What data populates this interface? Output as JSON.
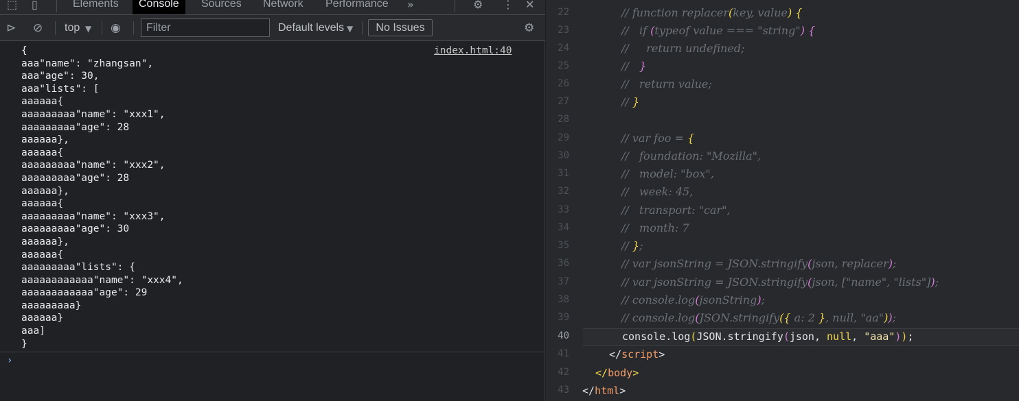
{
  "devtools": {
    "tabs": [
      "Elements",
      "Console",
      "Sources",
      "Network",
      "Performance"
    ],
    "more_tabs_icon": "chevron-double-right-icon",
    "toolbar": {
      "context": "top",
      "filter_placeholder": "Filter",
      "levels": "Default levels",
      "issues": "No Issues"
    },
    "console": {
      "source_link": "index.html:40",
      "log_lines": [
        "{",
        "aaa\"name\": \"zhangsan\",",
        "aaa\"age\": 30,",
        "aaa\"lists\": [",
        "aaaaaa{",
        "aaaaaaaaa\"name\": \"xxx1\",",
        "aaaaaaaaa\"age\": 28",
        "aaaaaa},",
        "aaaaaa{",
        "aaaaaaaaa\"name\": \"xxx2\",",
        "aaaaaaaaa\"age\": 28",
        "aaaaaa},",
        "aaaaaa{",
        "aaaaaaaaa\"name\": \"xxx3\",",
        "aaaaaaaaa\"age\": 30",
        "aaaaaa},",
        "aaaaaa{",
        "aaaaaaaaa\"lists\": {",
        "aaaaaaaaaaaa\"name\": \"xxx4\",",
        "aaaaaaaaaaaa\"age\": 29",
        "aaaaaaaaa}",
        "aaaaaa}",
        "aaa]",
        "}"
      ],
      "prompt": "›"
    }
  },
  "editor": {
    "line_numbers": [
      "22",
      "23",
      "24",
      "25",
      "26",
      "27",
      "28",
      "29",
      "30",
      "31",
      "32",
      "33",
      "34",
      "35",
      "36",
      "37",
      "38",
      "39",
      "40",
      "41",
      "42",
      "43"
    ],
    "l22": {
      "a": "// function replacer",
      "b": "(",
      "c": "key, value",
      "d": ") ",
      "e": "{"
    },
    "l23": {
      "a": "//   if ",
      "b": "(",
      "c": "typeof value === \"string\"",
      "d": ") ",
      "e": "{"
    },
    "l24": "//     return undefined;",
    "l25": {
      "a": "//   ",
      "b": "}"
    },
    "l26": "//   return value;",
    "l27": {
      "a": "// ",
      "b": "}"
    },
    "l29": {
      "a": "// var foo = ",
      "b": "{"
    },
    "l30": "//   foundation: \"Mozilla\",",
    "l31": "//   model: \"box\",",
    "l32": "//   week: 45,",
    "l33": "//   transport: \"car\",",
    "l34": "//   month: 7",
    "l35": {
      "a": "// ",
      "b": "}",
      "c": ";"
    },
    "l36": {
      "a": "// var jsonString = JSON.stringify",
      "b": "(",
      "c": "json, replacer",
      "d": ")",
      "e": ";"
    },
    "l37": {
      "a": "// var jsonString = JSON.stringify",
      "b": "(",
      "c": "json, [\"name\", \"lists\"]",
      "d": ")",
      "e": ";"
    },
    "l38": {
      "a": "// console.log",
      "b": "(",
      "c": "jsonString",
      "d": ")",
      "e": ";"
    },
    "l39": {
      "a": "// console.log",
      "b": "(",
      "c": "JSON.stringify",
      "d": "(",
      "e": "{",
      "f": " a: 2 ",
      "g": "}",
      "h": ", null, \"aa\"",
      "i": ")",
      "j": ")",
      "k": ";"
    },
    "l40": {
      "a": "console.log",
      "b": "(",
      "c": "JSON.stringify",
      "d": "(",
      "e": "json, ",
      "f": "null",
      "g": ", ",
      "h": "\"aaa\"",
      "i": ")",
      "j": ")",
      "k": ";"
    },
    "l41": {
      "a": "</",
      "b": "script",
      "c": ">"
    },
    "l42": {
      "a": "</",
      "b": "body",
      "c": ">"
    },
    "l43": {
      "a": "</",
      "b": "html",
      "c": ">"
    }
  }
}
